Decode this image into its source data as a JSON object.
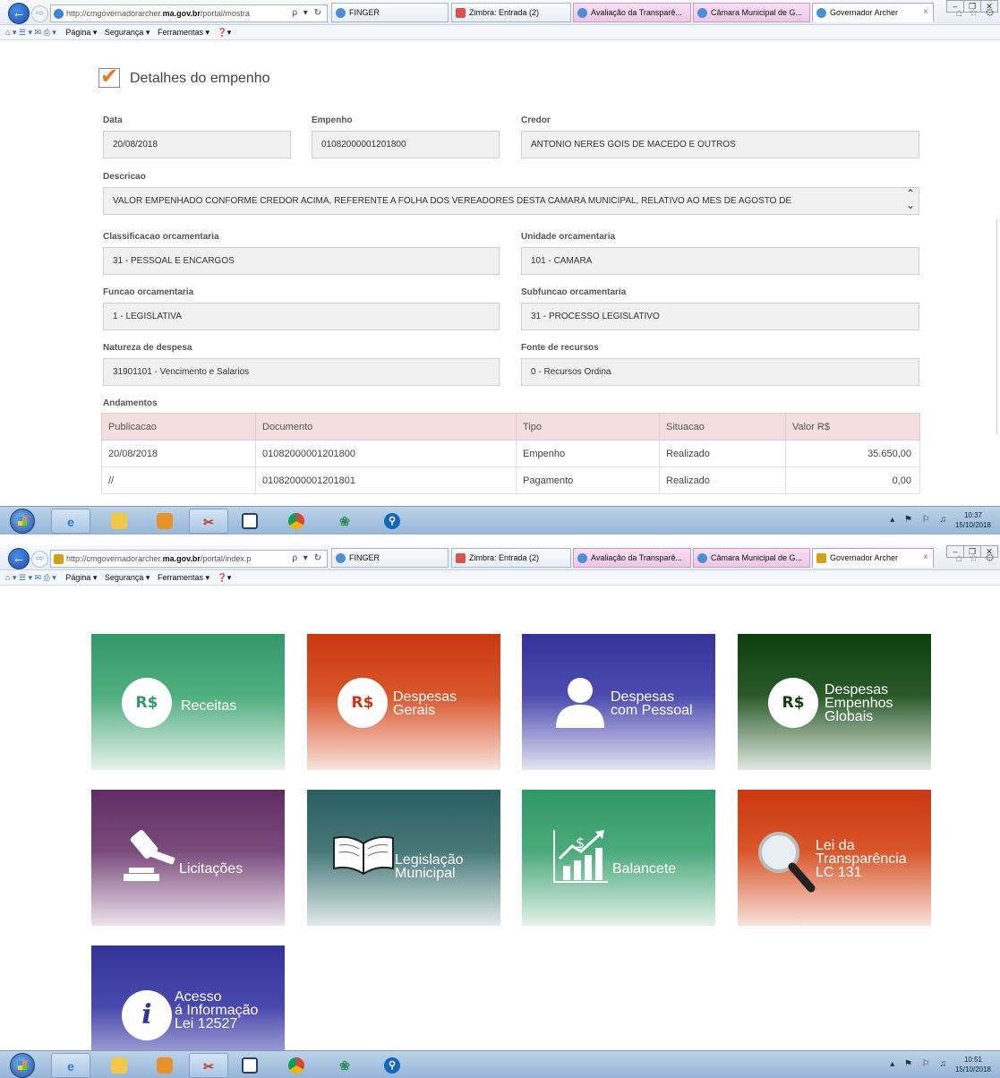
{
  "screen1": {
    "browser": {
      "url_prefix": "http://cmgovernadorarcher.",
      "url_domain": "ma.gov.br",
      "url_path": "/portal/mostra",
      "url_tools": "ρ ▾ ↻",
      "tabs": [
        "FINGER",
        "Zimbra: Entrada (2)",
        "Avaliação da Transparê...",
        "Câmara Municipal de G...",
        "Governador Archer"
      ],
      "close": "×",
      "right_tools": "⌂ ☆ ⚙",
      "win_controls": [
        "‒",
        "❐",
        "✕"
      ],
      "cmd_glyphs": "⌂ ▾  ☰ ▾  ✉  ⎙ ▾",
      "cmd_items": [
        "Página ▾",
        "Segurança ▾",
        "Ferramentas ▾",
        "❓▾"
      ]
    },
    "title": "Detalhes do empenho",
    "fields": {
      "data": {
        "label": "Data",
        "value": "20/08/2018"
      },
      "empenho": {
        "label": "Empenho",
        "value": "01082000001201800"
      },
      "credor": {
        "label": "Credor",
        "value": "ANTONIO NERES GOIS DE MACEDO E OUTROS"
      },
      "descricao": {
        "label": "Descricao",
        "value": "VALOR EMPENHADO CONFORME CREDOR ACIMA, REFERENTE A FOLHA  DOS VEREADORES DESTA CAMARA MUNICIPAL, RELATIVO AO MES DE AGOSTO DE"
      },
      "classificacao": {
        "label": "Classificacao orcamentaria",
        "value": "31 - PESSOAL E ENCARGOS"
      },
      "unidade": {
        "label": "Unidade orcamentaria",
        "value": "101 - CAMARA"
      },
      "funcao": {
        "label": "Funcao orcamentaria",
        "value": "1 - LEGISLATIVA"
      },
      "subfuncao": {
        "label": "Subfuncao orcamentaria",
        "value": "31 - PROCESSO LEGISLATIVO"
      },
      "natureza": {
        "label": "Natureza de despesa",
        "value": "31901101 - Vencimento e Salarios"
      },
      "fonte": {
        "label": "Fonte de recursos",
        "value": "0 - Recursos Ordina"
      }
    },
    "scroll_arrows": "⌃\n⌄",
    "andamentos": {
      "label": "Andamentos",
      "columns": [
        "Publicacao",
        "Documento",
        "Tipo",
        "Situacao",
        "Valor R$"
      ],
      "rows": [
        [
          "20/08/2018",
          "01082000001201800",
          "Empenho",
          "Realizado",
          "35.650,00"
        ],
        [
          "//",
          "01082000001201801",
          "Pagamento",
          "Realizado",
          "0,00"
        ]
      ]
    },
    "clock": {
      "time": "10:37",
      "date": "15/10/2018"
    }
  },
  "screen2": {
    "browser": {
      "url_prefix": "http://cmgovernadorarcher.",
      "url_domain": "ma.gov.br",
      "url_path": "/portal/index.p",
      "url_tools": "ρ ▾ ↻",
      "tabs": [
        "FINGER",
        "Zimbra: Entrada (2)",
        "Avaliação da Transparê...",
        "Câmara Municipal de G...",
        "Governador Archer"
      ],
      "close": "×",
      "right_tools": "⌂ ☆ ⚙",
      "win_controls": [
        "‒",
        "❐",
        "✕"
      ],
      "cmd_glyphs": "⌂ ▾  ☰ ▾  ✉  ⎙ ▾",
      "cmd_items": [
        "Página ▾",
        "Segurança ▾",
        "Ferramentas ▾",
        "❓▾"
      ]
    },
    "tiles": [
      {
        "label": "Receitas",
        "icon": "R$",
        "color": "#33996a"
      },
      {
        "label": "Despesas\nGerais",
        "icon": "R$",
        "color": "#c9380f"
      },
      {
        "label": "Despesas\ncom Pessoal",
        "icon": "person-icon",
        "color": "#33339a"
      },
      {
        "label": "Despesas\nEmpenhos\nGlobais",
        "icon": "R$",
        "color": "#0c3f0c"
      },
      {
        "label": "Licitações",
        "icon": "gavel-icon",
        "color": "#602c63"
      },
      {
        "label": "Legislação\nMunicipal",
        "icon": "book-icon",
        "color": "#2a5f5f"
      },
      {
        "label": "Balancete",
        "icon": "growth-chart-icon",
        "color": "#2f9865"
      },
      {
        "label": "Lei da\nTransparência\nLC 131",
        "icon": "magnifier-icon",
        "color": "#c9380f"
      },
      {
        "label": "Acesso\ná Informação\nLei 12527",
        "icon": "i",
        "color": "#33339a"
      }
    ],
    "clock": {
      "time": "10:51",
      "date": "15/10/2018"
    }
  },
  "taskbar_tray": "▴ ⚑ ⚐ ♫"
}
